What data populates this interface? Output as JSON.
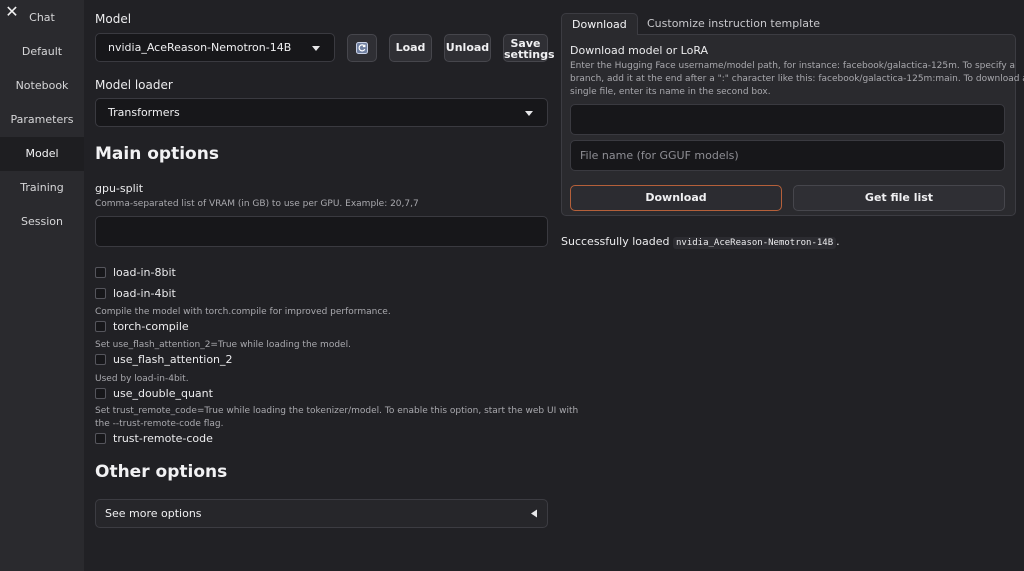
{
  "sidebar": {
    "close_glyph": "✕",
    "items": [
      {
        "label": "Chat"
      },
      {
        "label": "Default"
      },
      {
        "label": "Notebook"
      },
      {
        "label": "Parameters"
      },
      {
        "label": "Model"
      },
      {
        "label": "Training"
      },
      {
        "label": "Session"
      }
    ],
    "active": "Model"
  },
  "model": {
    "label": "Model",
    "selected": "nvidia_AceReason-Nemotron-14B",
    "refresh_icon": "refresh-icon",
    "load_label": "Load",
    "unload_label": "Unload",
    "save_label_line1": "Save",
    "save_label_line2": "settings"
  },
  "loader": {
    "label": "Model loader",
    "selected": "Transformers"
  },
  "main_options": {
    "title": "Main options",
    "gpu_split_label": "gpu-split",
    "gpu_split_hint": "Comma-separated list of VRAM (in GB) to use per GPU. Example: 20,7,7",
    "gpu_split_value": "",
    "checkboxes": [
      {
        "label": "load-in-8bit",
        "hint": "",
        "checked": false
      },
      {
        "label": "load-in-4bit",
        "hint": "",
        "checked": false
      },
      {
        "label": "torch-compile",
        "hint": "Compile the model with torch.compile for improved performance.",
        "checked": false
      },
      {
        "label": "use_flash_attention_2",
        "hint": "Set use_flash_attention_2=True while loading the model.",
        "checked": false
      },
      {
        "label": "use_double_quant",
        "hint": "Used by load-in-4bit.",
        "checked": false
      },
      {
        "label": "trust-remote-code",
        "hint_line1": "Set trust_remote_code=True while loading the tokenizer/model. To enable this option, start the web UI with",
        "hint_line2": "the --trust-remote-code flag.",
        "checked": false
      }
    ]
  },
  "other_options": {
    "title": "Other options",
    "accordion_label": "See more options"
  },
  "download_panel": {
    "tabs": [
      "Download",
      "Customize instruction template"
    ],
    "active_tab": "Download",
    "title": "Download model or LoRA",
    "desc_line1": "Enter the Hugging Face username/model path, for instance: facebook/galactica-125m. To specify a",
    "desc_line2": "branch, add it at the end after a \":\" character like this: facebook/galactica-125m:main. To download a",
    "desc_line3": "single file, enter its name in the second box.",
    "model_path_value": "",
    "file_name_placeholder": "File name (for GGUF models)",
    "download_label": "Download",
    "get_file_list_label": "Get file list"
  },
  "status": {
    "prefix": "Successfully loaded ",
    "model_name": "nvidia_AceReason-Nemotron-14B",
    "suffix": "."
  },
  "colors": {
    "background": "#212125",
    "sidebar": "#2a2a2e",
    "download_button_border": "#b5603a"
  }
}
